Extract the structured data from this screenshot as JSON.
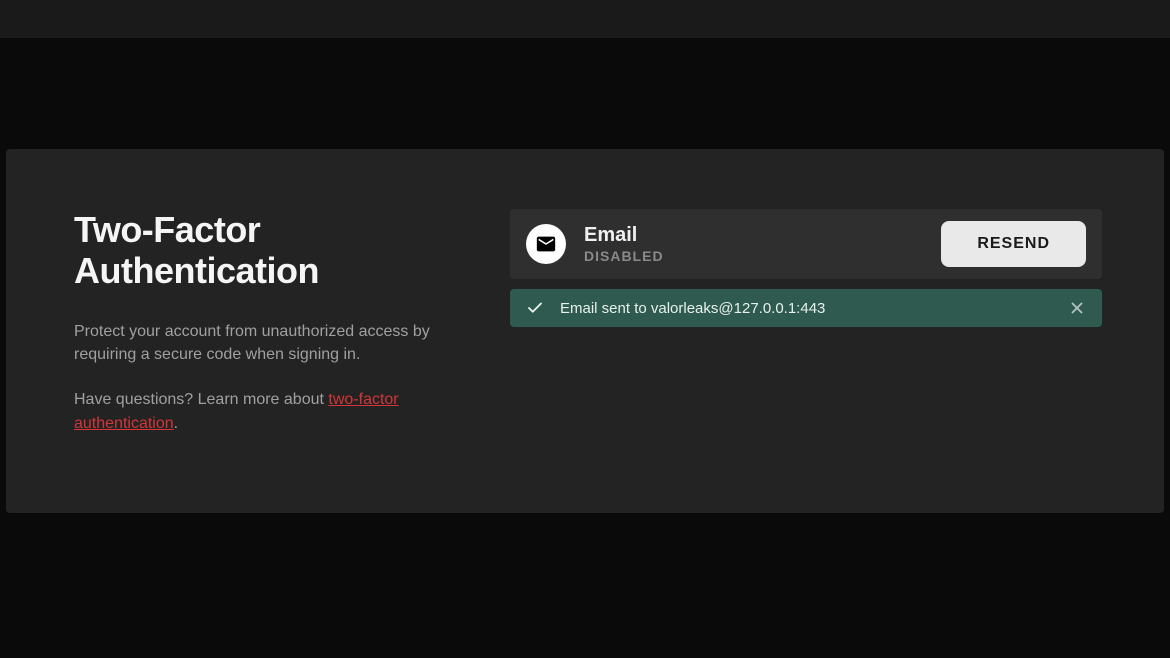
{
  "left": {
    "title": "Two-Factor Authentication",
    "description": "Protect your account from unauthorized access by requiring a secure code when signing in.",
    "help_prefix": "Have questions? Learn more about ",
    "help_link_text": "two-factor authentication",
    "help_suffix": "."
  },
  "method": {
    "name": "Email",
    "status": "DISABLED",
    "resend_label": "RESEND"
  },
  "toast": {
    "message": "Email sent to valorleaks@127.0.0.1:443"
  },
  "colors": {
    "panel_bg": "#232323",
    "card_bg": "#2f2f2f",
    "toast_bg": "#2e5a4f",
    "accent_red": "#d13639"
  }
}
